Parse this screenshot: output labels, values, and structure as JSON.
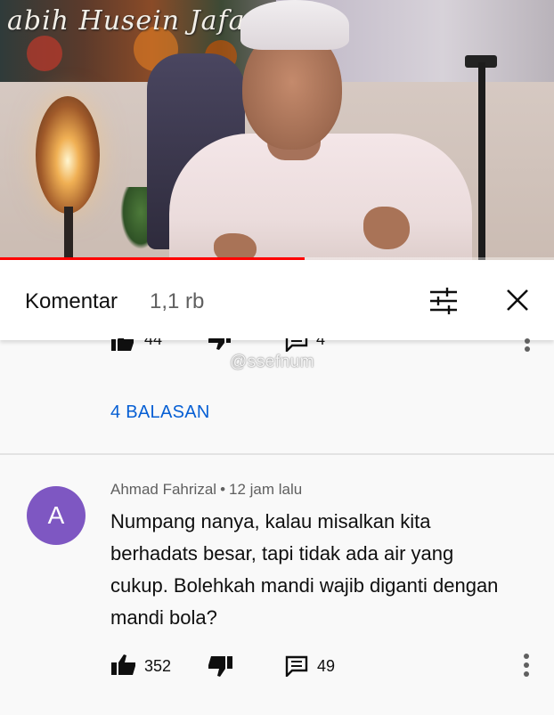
{
  "video": {
    "banner_text": "abih Husein Jafar",
    "progress": 0.55
  },
  "comments_header": {
    "title": "Komentar",
    "count": "1,1 rb",
    "filter_icon": "sort-filter-icon",
    "close_icon": "close-icon"
  },
  "previous_comment": {
    "likes": "44",
    "replies": "4"
  },
  "watermark": "@ssefnum",
  "replies_link": "4 BALASAN",
  "comment": {
    "avatar_letter": "A",
    "avatar_color": "#7e57c2",
    "author": "Ahmad Fahrizal",
    "separator": "•",
    "time": "12 jam lalu",
    "text": "Numpang nanya, kalau misalkan kita berhadats besar, tapi tidak ada air yang cukup. Bolehkah mandi wajib diganti dengan mandi bola?",
    "likes": "352",
    "replies": "49"
  },
  "colors": {
    "link": "#065fd4",
    "progress": "#ff0000",
    "text_secondary": "#606060"
  }
}
